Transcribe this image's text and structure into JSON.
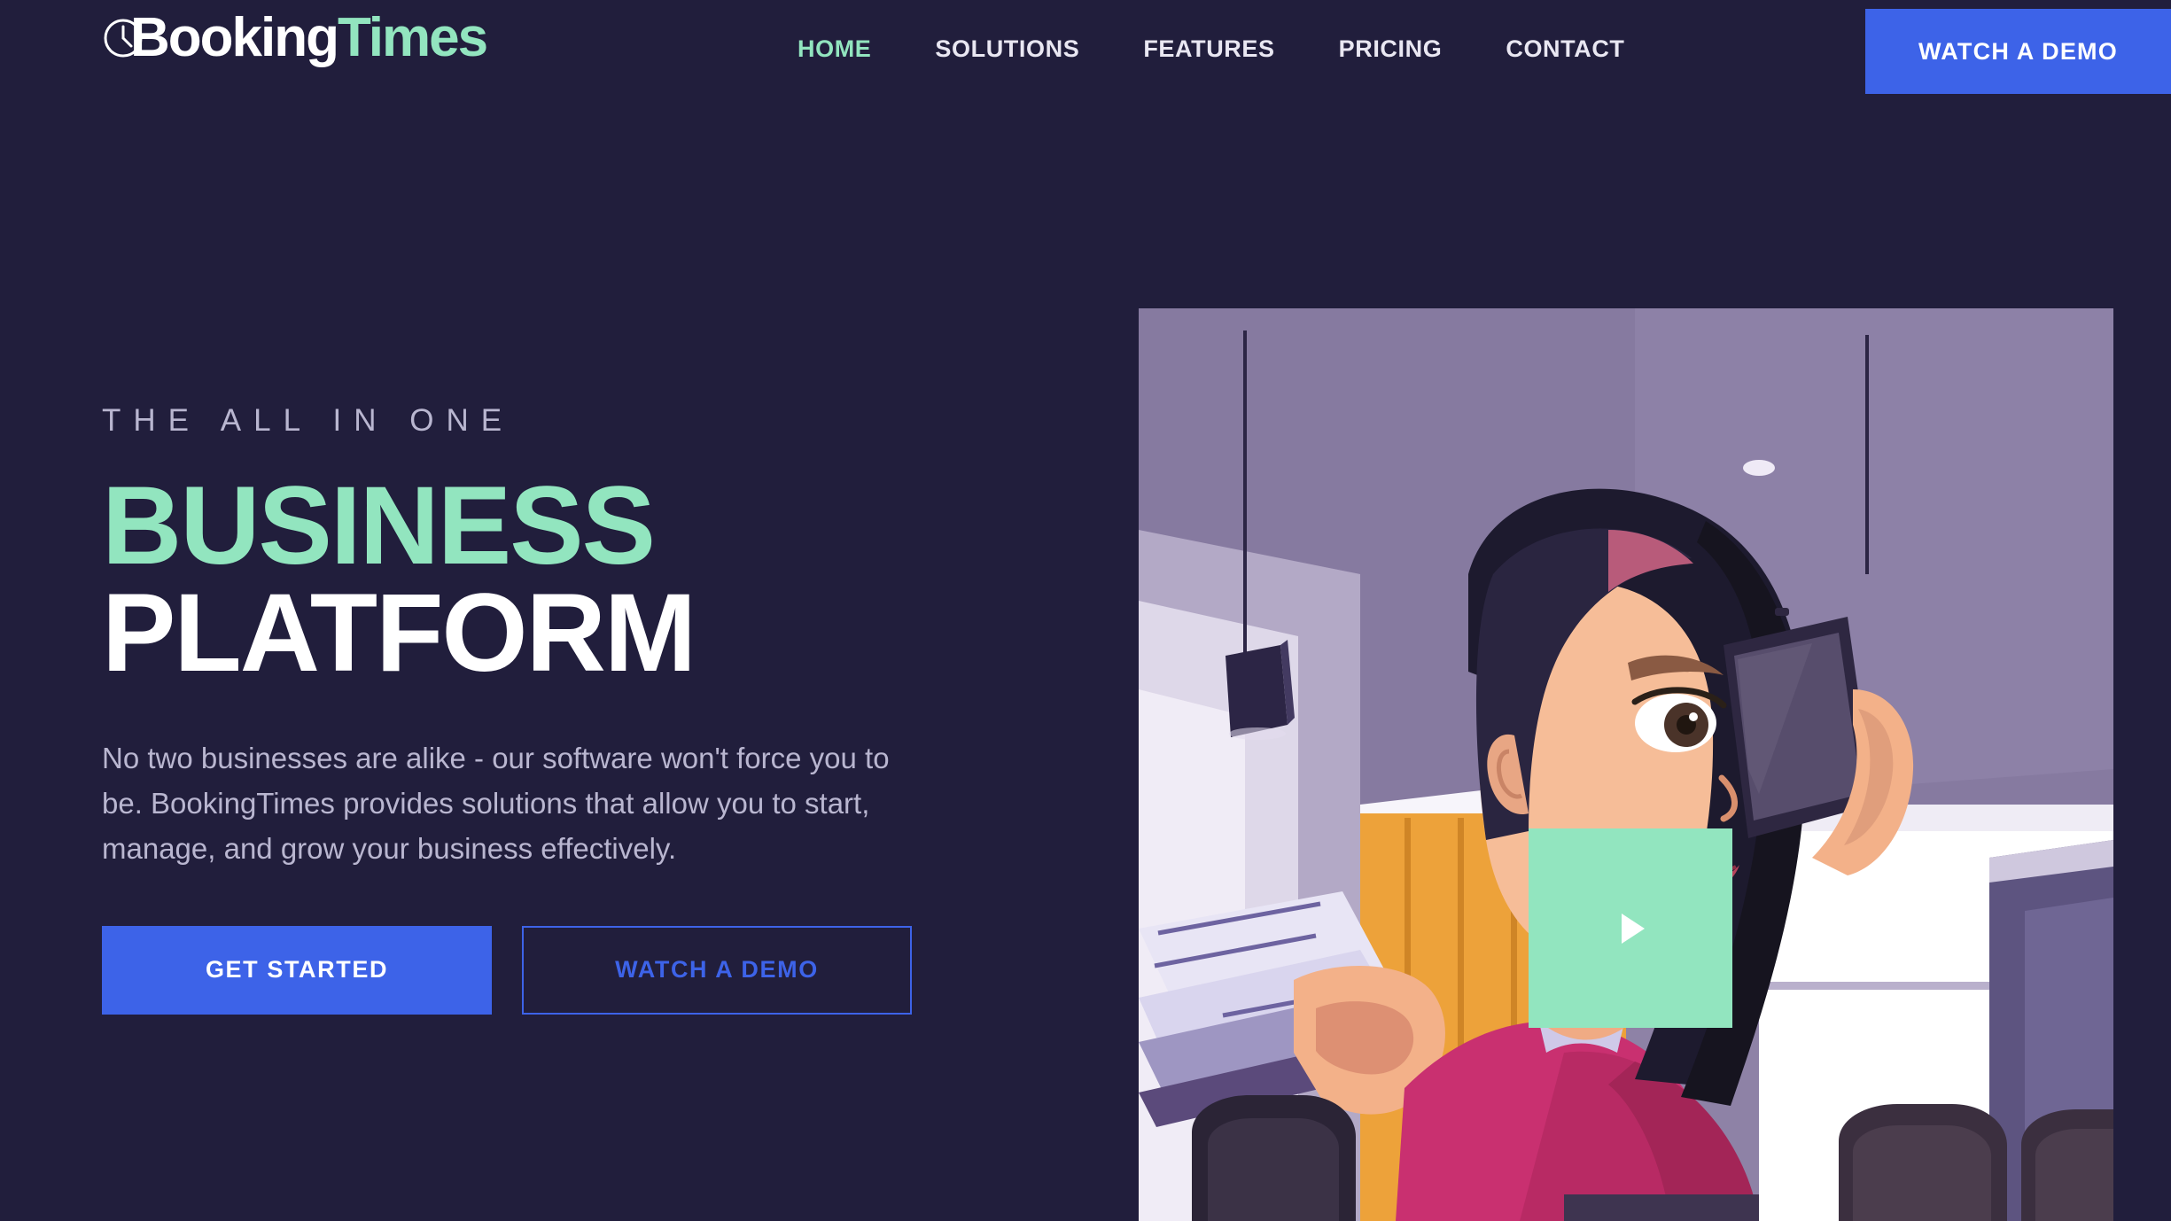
{
  "brand": {
    "name_part1": "Booking",
    "name_part2": "Times",
    "clock_icon": "clock-icon",
    "mint": "#92e5bf",
    "blue": "#3d63e8",
    "background": "#211e3c"
  },
  "nav": {
    "items": [
      {
        "label": "HOME",
        "active": true
      },
      {
        "label": "SOLUTIONS",
        "active": false
      },
      {
        "label": "FEATURES",
        "active": false
      },
      {
        "label": "PRICING",
        "active": false
      },
      {
        "label": "CONTACT",
        "active": false
      }
    ],
    "cta_label": "WATCH A DEMO"
  },
  "hero": {
    "eyebrow": "THE ALL IN ONE",
    "headline_line1": "BUSINESS",
    "headline_line2": "PLATFORM",
    "paragraph": "No two businesses are alike - our software won't force you to be. BookingTimes provides solutions that allow you to start, manage, and grow your business effectively.",
    "primary_button": "GET STARTED",
    "secondary_button": "WATCH A DEMO",
    "media": {
      "type": "illustration",
      "alt": "Illustrated woman in pink sweater talking on a smartphone while holding documents in an office",
      "play_button_icon": "play-icon",
      "play_button_color": "#92e5bf"
    }
  }
}
